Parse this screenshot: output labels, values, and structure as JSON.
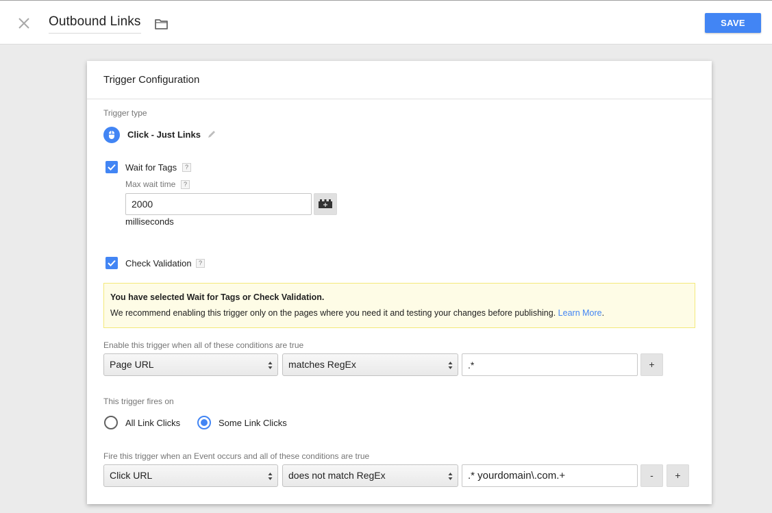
{
  "header": {
    "title": "Outbound Links",
    "save_label": "SAVE",
    "close_icon": "close-icon",
    "folder_icon": "folder-icon"
  },
  "card": {
    "title": "Trigger Configuration",
    "trigger_type": {
      "label": "Trigger type",
      "name": "Click - Just Links",
      "icon": "mouse-icon",
      "edit_icon": "pencil-icon"
    },
    "wait_for_tags": {
      "label": "Wait for Tags",
      "checked": true,
      "help": "?",
      "max_wait_label": "Max wait time",
      "max_wait_help": "?",
      "max_wait_value": "2000",
      "unit": "milliseconds",
      "variable_icon": "variable-block-icon"
    },
    "check_validation": {
      "label": "Check Validation",
      "checked": true,
      "help": "?"
    },
    "notice": {
      "title": "You have selected Wait for Tags or Check Validation.",
      "body": "We recommend enabling this trigger only on the pages where you need it and testing your changes before publishing.",
      "link": "Learn More",
      "period": ".",
      "background": "#fefce6",
      "border": "#f3e97a"
    },
    "enable_conditions": {
      "label": "Enable this trigger when all of these conditions are true",
      "variable": "Page URL",
      "operator": "matches RegEx",
      "value": ".*",
      "add_label": "+"
    },
    "fires_on": {
      "label": "This trigger fires on",
      "options": [
        {
          "label": "All Link Clicks",
          "selected": false
        },
        {
          "label": "Some Link Clicks",
          "selected": true
        }
      ]
    },
    "fire_conditions": {
      "label": "Fire this trigger when an Event occurs and all of these conditions are true",
      "variable": "Click URL",
      "operator": "does not match RegEx",
      "value": ".* yourdomain\\.com.+",
      "remove_label": "-",
      "add_label": "+"
    }
  },
  "colors": {
    "accent": "#4285f4",
    "page_background": "#ebebeb"
  }
}
